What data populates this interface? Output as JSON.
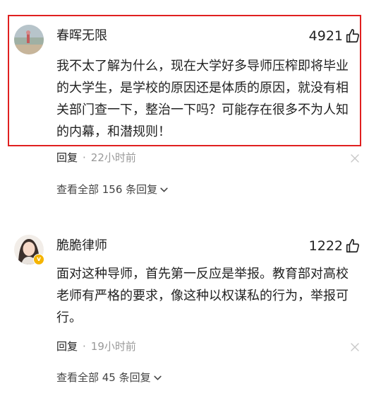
{
  "comments": [
    {
      "username": "春晖无限",
      "likes": "4921",
      "content": "我不太了解为什么，现在大学好多导师压榨即将毕业的大学生，是学校的原因还是体质的原因，就没有相关部门查一下，整治一下吗？可能存在很多不为人知的内幕，和潜规则！",
      "reply_label": "回复",
      "separator": "·",
      "time": "22小时前",
      "view_replies": "查看全部 156 条回复",
      "highlighted": true
    },
    {
      "username": "脆脆律师",
      "likes": "1222",
      "verified_badge": "v",
      "content": "面对这种导师，首先第一反应是举报。教育部对高校老师有严格的要求，像这种以权谋私的行为，举报可行。",
      "reply_label": "回复",
      "separator": "·",
      "time": "19小时前",
      "view_replies": "查看全部 45 条回复",
      "highlighted": false
    }
  ],
  "icons": {
    "like": "thumbs-up-icon",
    "close": "close-icon",
    "expand": "chevron-down-icon",
    "verified": "verified-badge-icon"
  },
  "colors": {
    "highlight_border": "#e02020",
    "badge": "#f5b400",
    "muted_text": "#999999",
    "main_text": "#222222"
  }
}
